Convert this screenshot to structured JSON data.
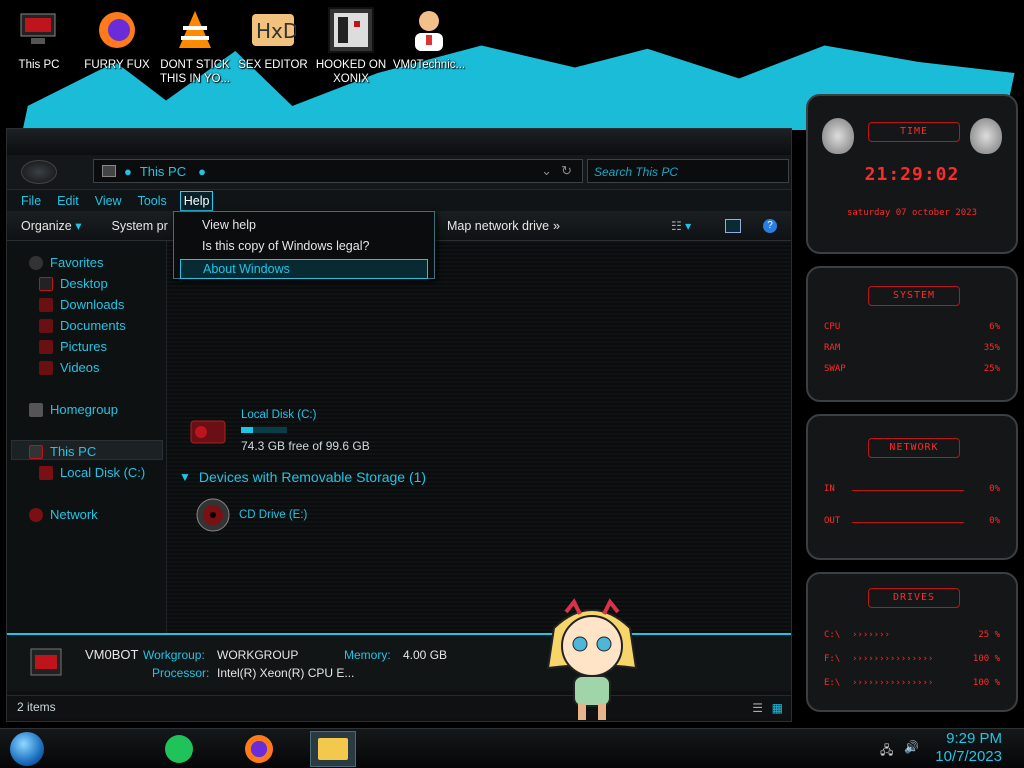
{
  "desktop": {
    "icons": [
      {
        "label": "This PC",
        "icon": "computer-icon"
      },
      {
        "label": "FURRY FUX",
        "icon": "firefox-icon"
      },
      {
        "label": "DONT STICK THIS IN YO...",
        "icon": "vlc-icon"
      },
      {
        "label": "SEX EDITOR",
        "icon": "hxd-icon"
      },
      {
        "label": "HOOKED ON XONIX",
        "icon": "game-icon"
      },
      {
        "label": "VM0Technic...",
        "icon": "doctor-icon"
      }
    ]
  },
  "explorer": {
    "address": "This PC",
    "search_placeholder": "Search This PC",
    "menu": [
      "File",
      "Edit",
      "View",
      "Tools",
      "Help"
    ],
    "active_menu": "Help",
    "help_menu": [
      "View help",
      "Is this copy of Windows legal?",
      "About Windows"
    ],
    "highlighted_item": "About Windows",
    "commands": {
      "organize": "Organize",
      "system": "System pr",
      "map": "Map network drive",
      "more": "»"
    },
    "nav": {
      "favorites": "Favorites",
      "desktop": "Desktop",
      "downloads": "Downloads",
      "documents": "Documents",
      "pictures": "Pictures",
      "videos": "Videos",
      "homegroup": "Homegroup",
      "this_pc": "This PC",
      "local_disk": "Local Disk (C:)",
      "network": "Network"
    },
    "content": {
      "disk_name": "Local Disk (C:)",
      "disk_free": "74.3 GB free of 99.6 GB",
      "disk_used_fraction": 0.25,
      "removable_header": "Devices with Removable Storage (1)",
      "cd_drive": "CD Drive (E:)"
    },
    "details": {
      "computer_name": "VM0BOT",
      "workgroup_label": "Workgroup:",
      "workgroup": "WORKGROUP",
      "memory_label": "Memory:",
      "memory": "4.00 GB",
      "processor_label": "Processor:",
      "processor": "Intel(R) Xeon(R) CPU E..."
    },
    "status": "2 items"
  },
  "gadgets": {
    "time": {
      "title": "TIME",
      "clock": "21:29:02",
      "date": "saturday 07 october 2023"
    },
    "system": {
      "title": "SYSTEM",
      "cpu_label": "CPU",
      "cpu": "6%",
      "ram_label": "RAM",
      "ram": "35%",
      "swap_label": "SWAP",
      "swap": "25%"
    },
    "network": {
      "title": "NETWORK",
      "in_label": "IN",
      "in": "0%",
      "out_label": "OUT",
      "out": "0%"
    },
    "drives": {
      "title": "DRIVES",
      "c_label": "C:\\",
      "c": "25 %",
      "f_label": "F:\\",
      "f": "100 %",
      "e_label": "E:\\",
      "e": "100 %"
    }
  },
  "taskbar": {
    "time": "9:29 PM",
    "date": "10/7/2023"
  }
}
